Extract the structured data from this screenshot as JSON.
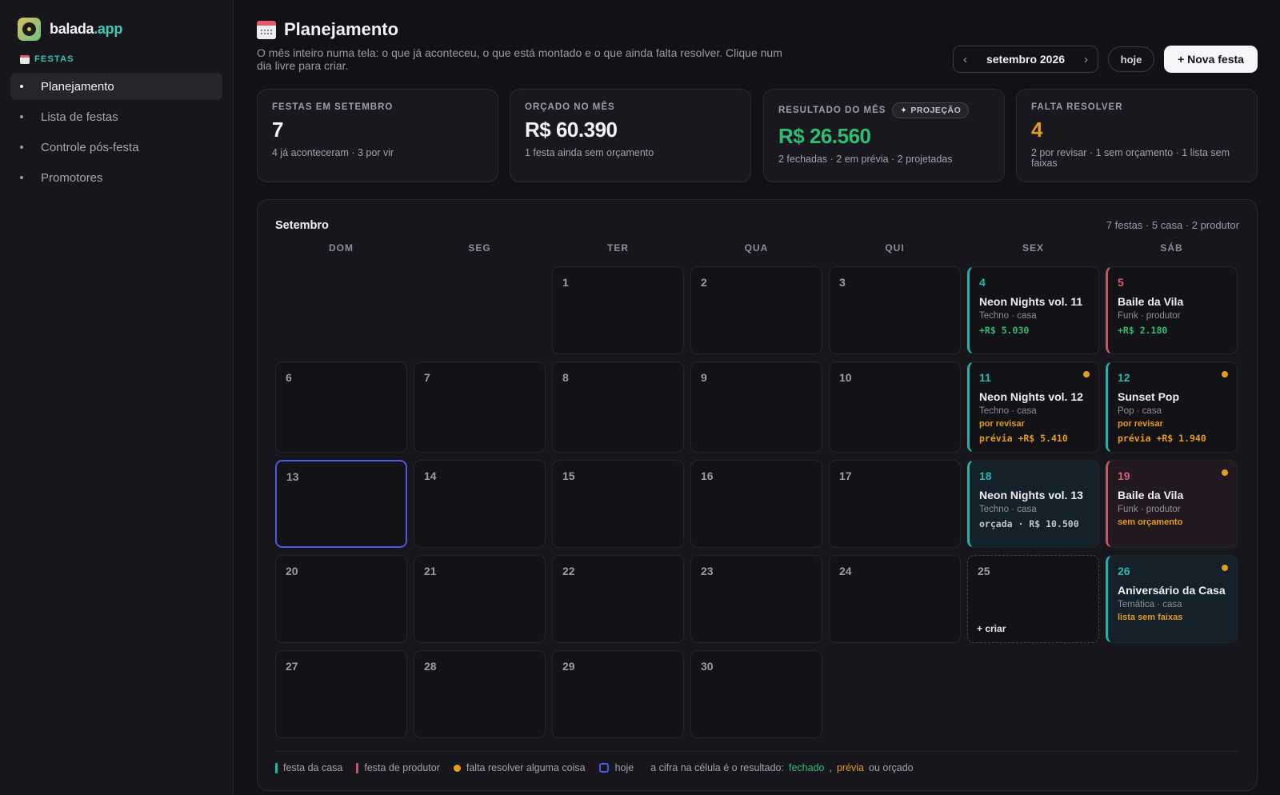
{
  "brand": {
    "name": "balada",
    "suffix": ".app"
  },
  "sidebar": {
    "section_label": "FESTAS",
    "items": [
      {
        "label": "Planejamento",
        "active": true
      },
      {
        "label": "Lista de festas",
        "active": false
      },
      {
        "label": "Controle pós-festa",
        "active": false
      },
      {
        "label": "Promotores",
        "active": false
      }
    ]
  },
  "header": {
    "title": "Planejamento",
    "subtitle": "O mês inteiro numa tela: o que já aconteceu, o que está montado e o que ainda falta resolver. Clique num dia livre para criar.",
    "month_label": "setembro 2026",
    "prev_icon": "‹",
    "next_icon": "›",
    "today_button": "hoje",
    "new_button": "+ Nova festa"
  },
  "kpis": {
    "festas": {
      "label": "FESTAS EM SETEMBRO",
      "value": "7",
      "sub": "4 já aconteceram · 3 por vir"
    },
    "orcado": {
      "label": "ORÇADO NO MÊS",
      "value": "R$ 60.390",
      "sub": "1 festa ainda sem orçamento"
    },
    "resultado": {
      "label": "RESULTADO DO MÊS",
      "badge": "PROJEÇÃO",
      "value": "R$ 26.560",
      "sub": "2 fechadas · 2 em prévia · 2 projetadas"
    },
    "falta": {
      "label": "FALTA RESOLVER",
      "value": "4",
      "sub": "2 por revisar · 1 sem orçamento · 1 lista sem faixas"
    }
  },
  "calendar": {
    "title": "Setembro",
    "meta": "7 festas · 5 casa · 2 produtor",
    "weekdays": [
      "DOM",
      "SEG",
      "TER",
      "QUA",
      "QUI",
      "SEX",
      "SÁB"
    ],
    "days": {
      "d1": "1",
      "d2": "2",
      "d3": "3",
      "d6": "6",
      "d7": "7",
      "d8": "8",
      "d9": "9",
      "d10": "10",
      "d13": "13",
      "d14": "14",
      "d15": "15",
      "d16": "16",
      "d17": "17",
      "d20": "20",
      "d21": "21",
      "d22": "22",
      "d23": "23",
      "d24": "24",
      "d25": "25",
      "d27": "27",
      "d28": "28",
      "d29": "29",
      "d30": "30"
    },
    "create_label": "+ criar",
    "events": {
      "e4": {
        "day": "4",
        "title": "Neon Nights vol. 11",
        "meta": "Techno · casa",
        "result": "+R$ 5.030"
      },
      "e5": {
        "day": "5",
        "title": "Baile da Vila",
        "meta": "Funk · produtor",
        "result": "+R$ 2.180"
      },
      "e11": {
        "day": "11",
        "title": "Neon Nights vol. 12",
        "meta": "Techno · casa",
        "flag": "por revisar",
        "result": "prévia +R$ 5.410"
      },
      "e12": {
        "day": "12",
        "title": "Sunset Pop",
        "meta": "Pop · casa",
        "flag": "por revisar",
        "result": "prévia +R$ 1.940"
      },
      "e18": {
        "day": "18",
        "title": "Neon Nights vol. 13",
        "meta": "Techno · casa",
        "result": "orçada · R$ 10.500"
      },
      "e19": {
        "day": "19",
        "title": "Baile da Vila",
        "meta": "Funk · produtor",
        "flag": "sem orçamento"
      },
      "e26": {
        "day": "26",
        "title": "Aniversário da Casa",
        "meta": "Temática · casa",
        "flag": "lista sem faixas"
      }
    }
  },
  "legend": {
    "casa": "festa da casa",
    "produtor": "festa de produtor",
    "falta": "falta resolver alguma coisa",
    "hoje": "hoje",
    "cifra": "a cifra na célula é o resultado:",
    "fechado": "fechado",
    "comma": ",",
    "previa": "prévia",
    "orcado": "ou orçado"
  },
  "colors": {
    "casa": "#23b3ab",
    "produtor": "#c4566a",
    "alert": "#e49b1e",
    "positive": "#2ebd72",
    "today": "#4a5be0"
  }
}
